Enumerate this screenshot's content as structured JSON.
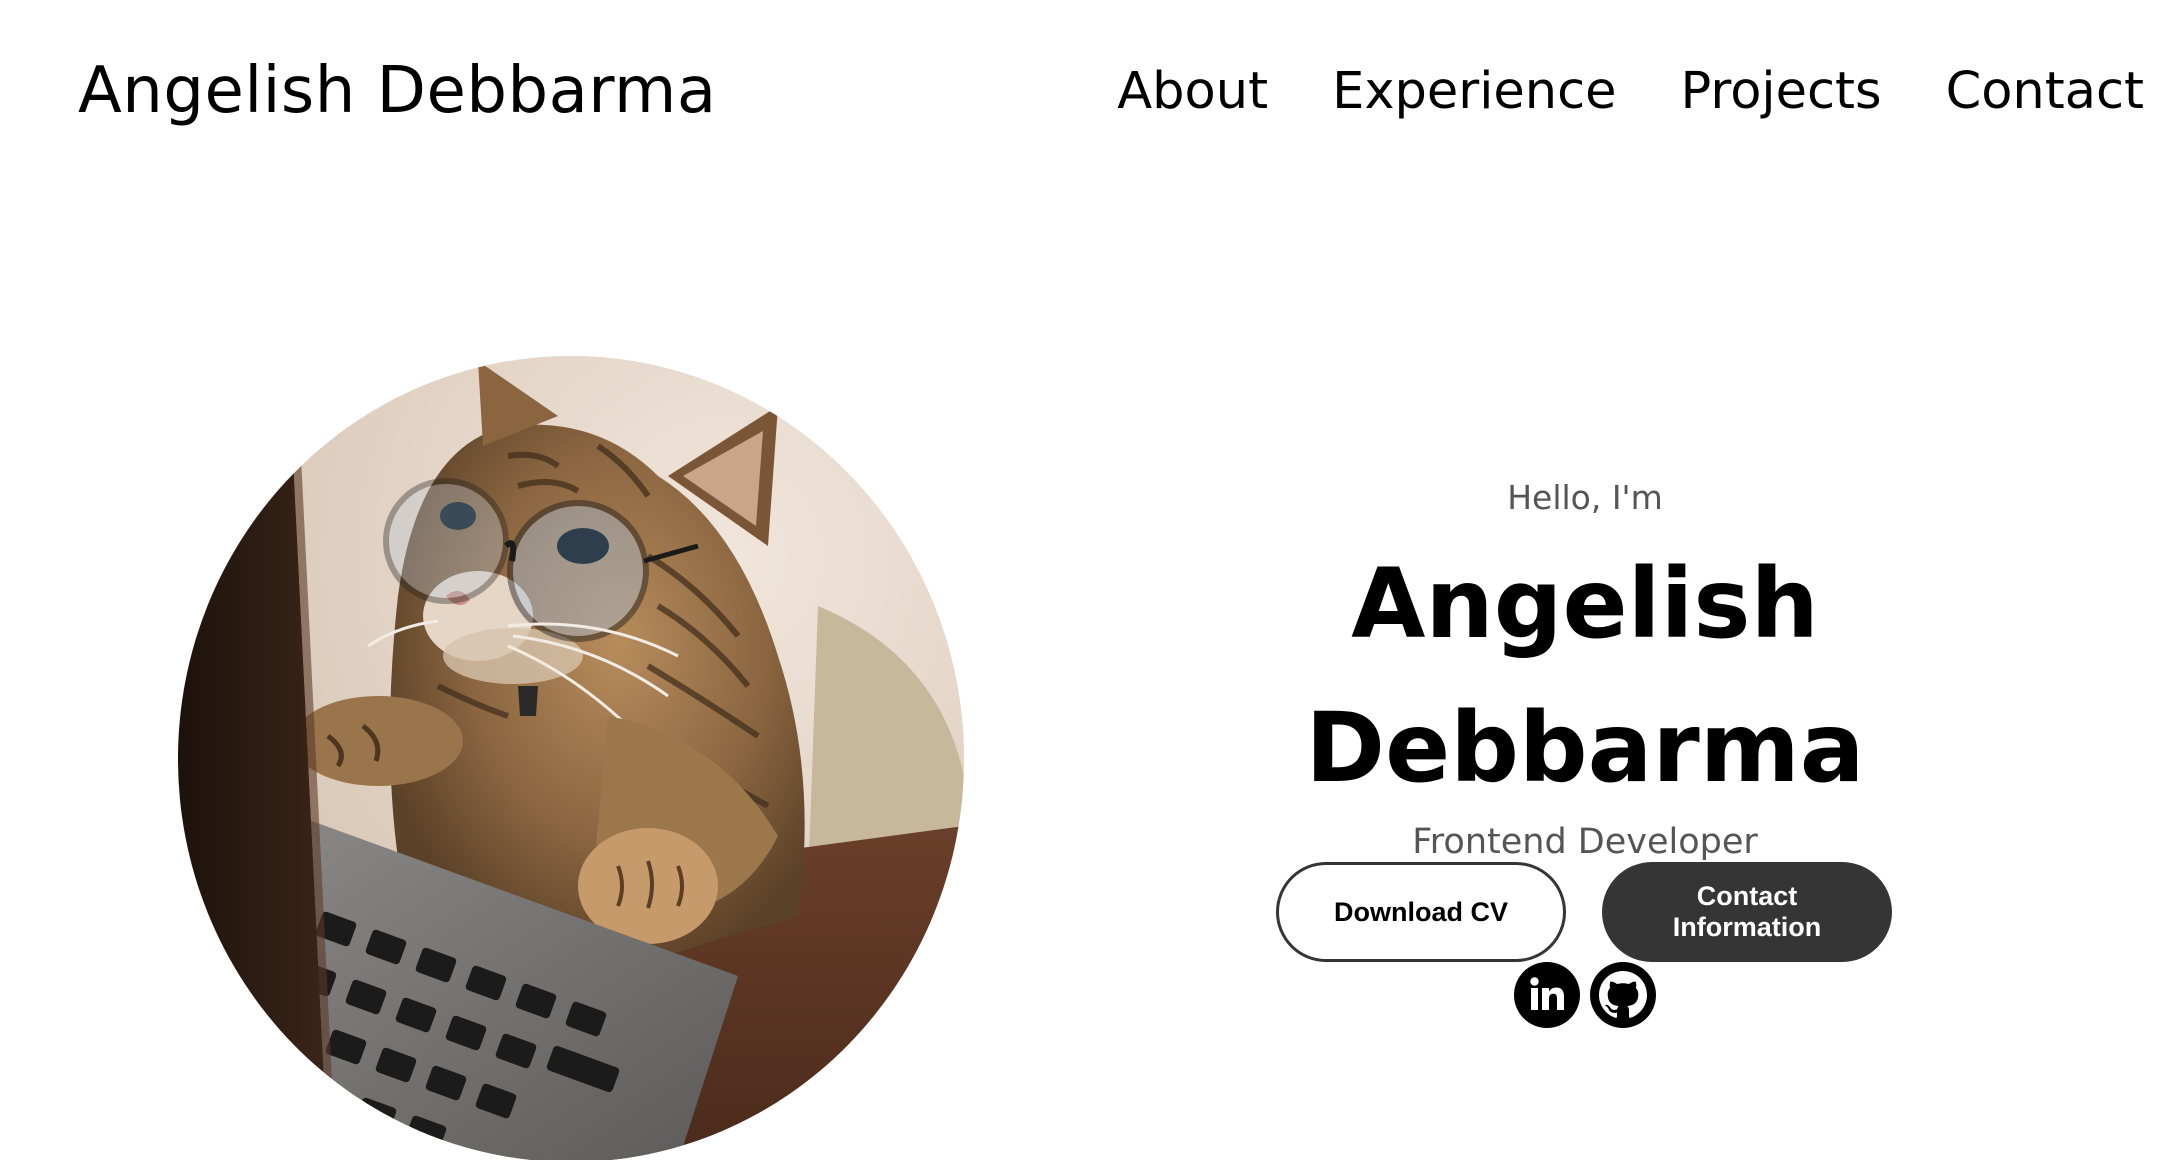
{
  "header": {
    "logo": "Angelish Debbarma",
    "nav": [
      "About",
      "Experience",
      "Projects",
      "Contact"
    ]
  },
  "hero": {
    "greeting": "Hello, I'm",
    "name_line1": "Angelish",
    "name_line2": "Debbarma",
    "role": "Frontend Developer",
    "download_cv_label": "Download CV",
    "contact_label_line1": "Contact",
    "contact_label_line2": "Information"
  },
  "socials": [
    "linkedin-icon",
    "github-icon"
  ],
  "colors": {
    "button_dark": "#353535",
    "text_muted": "#555555"
  }
}
